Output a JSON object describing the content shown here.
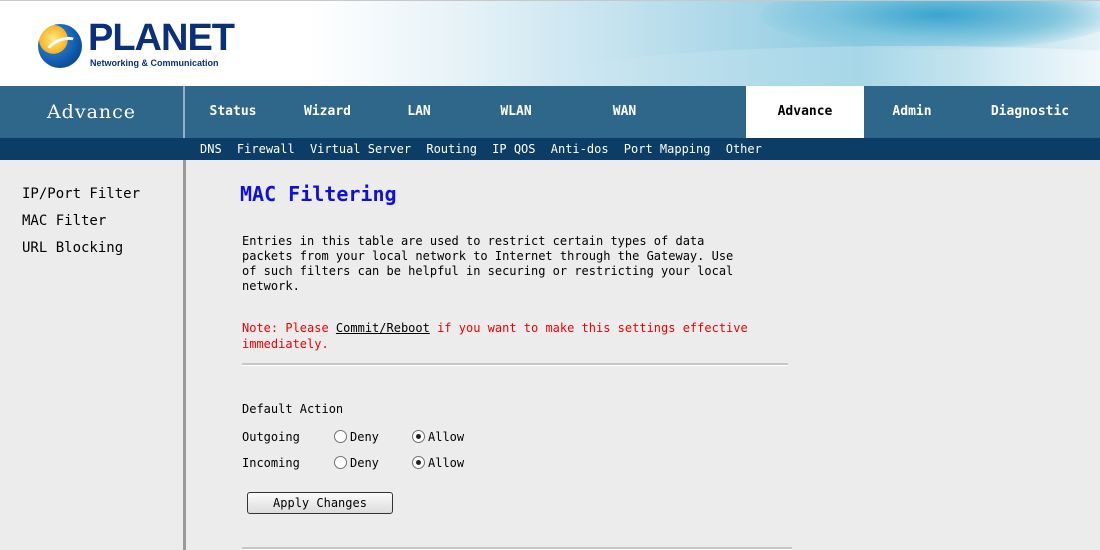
{
  "header": {
    "brand": "PLANET",
    "tagline": "Networking & Communication"
  },
  "nav": {
    "section_title": "Advance",
    "tabs": [
      {
        "label": "Status"
      },
      {
        "label": "Wizard"
      },
      {
        "label": "LAN"
      },
      {
        "label": "WLAN"
      },
      {
        "label": "WAN"
      },
      {
        "label": "Advance",
        "active": true
      },
      {
        "label": "Admin"
      },
      {
        "label": "Diagnostic"
      }
    ]
  },
  "submenu": {
    "items": [
      "DNS",
      "Firewall",
      "Virtual Server",
      "Routing",
      "IP QOS",
      "Anti-dos",
      "Port Mapping",
      "Other"
    ]
  },
  "sidebar": {
    "items": [
      {
        "label": "IP/Port Filter"
      },
      {
        "label": "MAC Filter"
      },
      {
        "label": "URL Blocking"
      }
    ]
  },
  "main": {
    "title": "MAC Filtering",
    "description_lines": [
      "Entries in this table are used to restrict certain types of data",
      "packets from your local network to Internet through the Gateway. Use",
      "of such filters can be helpful in securing or restricting your local",
      "network."
    ],
    "note_prefix": "Note: Please ",
    "note_link": "Commit/Reboot",
    "note_suffix_line1": " if you want to make this settings effective",
    "note_line2": "immediately.",
    "default_action_label": "Default Action",
    "outgoing": {
      "label": "Outgoing",
      "options": [
        "Deny",
        "Allow"
      ],
      "selected": "Allow"
    },
    "incoming": {
      "label": "Incoming",
      "options": [
        "Deny",
        "Allow"
      ],
      "selected": "Allow"
    },
    "apply_button": "Apply Changes"
  },
  "colors": {
    "nav_bg": "#2e6789",
    "submenu_bg": "#0b3d66",
    "title_blue": "#1010d6",
    "note_red": "#ee0000",
    "content_bg": "#ececec"
  }
}
